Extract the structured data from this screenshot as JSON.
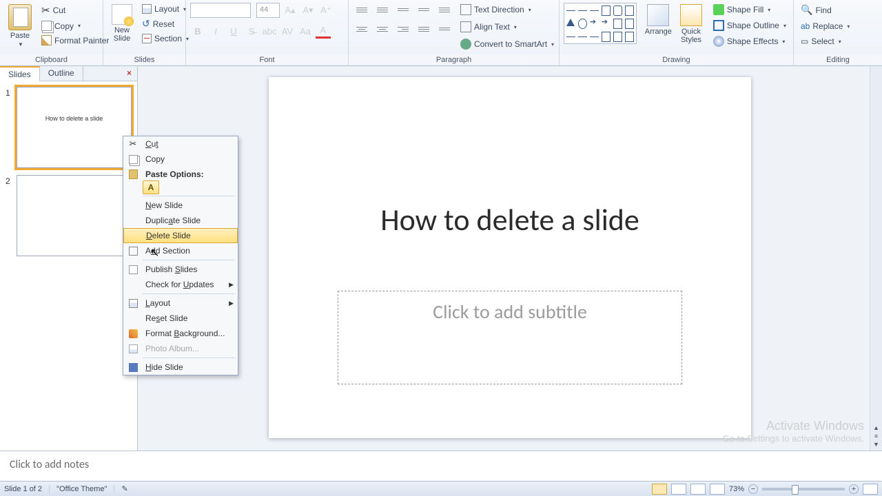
{
  "ribbon": {
    "groups": {
      "clipboard": {
        "title": "Clipboard",
        "paste": "Paste",
        "cut": "Cut",
        "copy": "Copy",
        "format_painter": "Format Painter"
      },
      "slides": {
        "title": "Slides",
        "new_slide": "New\nSlide",
        "layout": "Layout",
        "reset": "Reset",
        "section": "Section"
      },
      "font": {
        "title": "Font",
        "size": "44"
      },
      "paragraph": {
        "title": "Paragraph",
        "text_direction": "Text Direction",
        "align_text": "Align Text",
        "convert_smartart": "Convert to SmartArt"
      },
      "drawing": {
        "title": "Drawing",
        "arrange": "Arrange",
        "quick_styles": "Quick\nStyles",
        "shape_fill": "Shape Fill",
        "shape_outline": "Shape Outline",
        "shape_effects": "Shape Effects"
      },
      "editing": {
        "title": "Editing",
        "find": "Find",
        "replace": "Replace",
        "select": "Select"
      }
    }
  },
  "panel": {
    "tab_slides": "Slides",
    "tab_outline": "Outline"
  },
  "thumbs": [
    {
      "num": "1",
      "title": "How to delete a slide",
      "selected": true
    },
    {
      "num": "2",
      "title": "",
      "selected": false
    }
  ],
  "slide": {
    "title": "How to delete a slide",
    "subtitle_placeholder": "Click to add subtitle"
  },
  "watermark": {
    "line1": "Activate Windows",
    "line2": "Go to Settings to activate Windows."
  },
  "notes": {
    "placeholder": "Click to add notes"
  },
  "status": {
    "slide_pos": "Slide 1 of 2",
    "theme": "\"Office Theme\"",
    "zoom": "73%"
  },
  "context_menu": {
    "cut": "Cut",
    "copy": "Copy",
    "paste_options": "Paste Options:",
    "new_slide": "New Slide",
    "duplicate_slide": "Duplicate Slide",
    "delete_slide": "Delete Slide",
    "add_section": "Add Section",
    "publish_slides": "Publish Slides",
    "check_updates": "Check for Updates",
    "layout": "Layout",
    "reset_slide": "Reset Slide",
    "format_background": "Format Background...",
    "photo_album": "Photo Album...",
    "hide_slide": "Hide Slide"
  }
}
